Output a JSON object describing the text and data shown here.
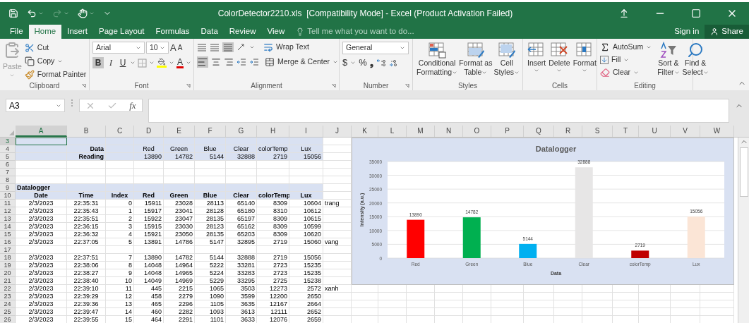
{
  "window": {
    "title": "ColorDetector2210.xls  [Compatibility Mode] - Excel (Product Activation Failed)"
  },
  "ribbon_tabs": [
    {
      "label": "File",
      "selected": false
    },
    {
      "label": "Home",
      "selected": true
    },
    {
      "label": "Insert",
      "selected": false
    },
    {
      "label": "Page Layout",
      "selected": false
    },
    {
      "label": "Formulas",
      "selected": false
    },
    {
      "label": "Data",
      "selected": false
    },
    {
      "label": "Review",
      "selected": false
    },
    {
      "label": "View",
      "selected": false
    }
  ],
  "tell_me": {
    "placeholder": "Tell me what you want to do..."
  },
  "account": {
    "sign_in": "Sign in",
    "share": "Share"
  },
  "ribbon": {
    "clipboard": {
      "paste": "Paste",
      "cut": "Cut",
      "copy": "Copy",
      "format_painter": "Format Painter",
      "label": "Clipboard"
    },
    "font": {
      "font_name": "Arial",
      "font_size": "10",
      "grow": "A",
      "shrink": "A",
      "bold": "B",
      "italic": "I",
      "underline": "U",
      "font_color": "A",
      "label": "Font"
    },
    "alignment": {
      "wrap_text": "Wrap Text",
      "merge": "Merge & Center",
      "label": "Alignment"
    },
    "number": {
      "format": "General",
      "currency": "$",
      "percent": "%",
      "comma": "❟",
      "label": "Number"
    },
    "styles": {
      "buttons": [
        [
          "Conditional",
          "Formatting"
        ],
        [
          "Format as",
          "Table"
        ],
        [
          "Cell",
          "Styles"
        ]
      ],
      "label": "Styles"
    },
    "cells": {
      "buttons": [
        "Insert",
        "Delete",
        "Format"
      ],
      "label": "Cells"
    },
    "editing": {
      "autosum": "AutoSum",
      "fill": "Fill",
      "clear": "Clear",
      "sort": [
        "Sort &",
        "Filter"
      ],
      "find": [
        "Find &",
        "Select"
      ],
      "label": "Editing"
    }
  },
  "formula_bar": {
    "name_box": "A3",
    "function_symbol": "fx"
  },
  "sheet": {
    "columns": [
      {
        "label": "A",
        "selected": true
      },
      {
        "label": "B",
        "selected": false
      },
      {
        "label": "C",
        "selected": false
      },
      {
        "label": "D",
        "selected": false
      },
      {
        "label": "E",
        "selected": false
      },
      {
        "label": "F",
        "selected": false
      },
      {
        "label": "G",
        "selected": false
      },
      {
        "label": "H",
        "selected": false
      },
      {
        "label": "I",
        "selected": false
      },
      {
        "label": "J",
        "selected": false
      },
      {
        "label": "K",
        "selected": false
      },
      {
        "label": "L",
        "selected": false
      },
      {
        "label": "M",
        "selected": false
      },
      {
        "label": "N",
        "selected": false
      },
      {
        "label": "O",
        "selected": false
      },
      {
        "label": "P",
        "selected": false
      },
      {
        "label": "Q",
        "selected": false
      },
      {
        "label": "R",
        "selected": false
      },
      {
        "label": "S",
        "selected": false
      },
      {
        "label": "T",
        "selected": false
      },
      {
        "label": "U",
        "selected": false
      },
      {
        "label": "V",
        "selected": false
      },
      {
        "label": "W",
        "selected": false
      }
    ],
    "rows": [
      {
        "number": "3",
        "kind": "blank",
        "shaded": true,
        "selected": true,
        "cells": {}
      },
      {
        "number": "4",
        "kind": "label",
        "shaded": true,
        "selected": false,
        "cells": {
          "B": "Data",
          "D": "Red",
          "E": "Green",
          "F": "Blue",
          "G": "Clear",
          "H": "colorTemp",
          "I": "Lux"
        }
      },
      {
        "number": "5",
        "kind": "reading",
        "shaded": true,
        "selected": false,
        "cells": {
          "B": "Reading",
          "D": "13890",
          "E": "14782",
          "F": "5144",
          "G": "32888",
          "H": "2719",
          "I": "15056"
        }
      },
      {
        "number": "6",
        "kind": "blank",
        "shaded": false,
        "selected": false,
        "cells": {}
      },
      {
        "number": "7",
        "kind": "blank",
        "shaded": false,
        "selected": false,
        "cells": {}
      },
      {
        "number": "8",
        "kind": "blank",
        "shaded": false,
        "selected": false,
        "cells": {}
      },
      {
        "number": "9",
        "kind": "section",
        "shaded": true,
        "selected": false,
        "cells": {
          "A": "Datalogger"
        }
      },
      {
        "number": "10",
        "kind": "header",
        "shaded": true,
        "selected": false,
        "cells": {
          "A": "Date",
          "B": "Time",
          "C": "Index",
          "D": "Red",
          "E": "Green",
          "F": "Blue",
          "G": "Clear",
          "H": "colorTemp",
          "I": "Lux"
        }
      },
      {
        "number": "11",
        "kind": "data",
        "shaded": false,
        "selected": false,
        "cells": {
          "A": "2/3/2023",
          "B": "22:35:31",
          "C": "0",
          "D": "15911",
          "E": "23028",
          "F": "28113",
          "G": "65140",
          "H": "8309",
          "I": "10604",
          "J": "trang"
        }
      },
      {
        "number": "12",
        "kind": "data",
        "shaded": false,
        "selected": false,
        "cells": {
          "A": "2/3/2023",
          "B": "22:35:43",
          "C": "1",
          "D": "15917",
          "E": "23041",
          "F": "28128",
          "G": "65180",
          "H": "8310",
          "I": "10612"
        }
      },
      {
        "number": "13",
        "kind": "data",
        "shaded": false,
        "selected": false,
        "cells": {
          "A": "2/3/2023",
          "B": "22:35:51",
          "C": "2",
          "D": "15922",
          "E": "23047",
          "F": "28135",
          "G": "65197",
          "H": "8309",
          "I": "10615"
        }
      },
      {
        "number": "14",
        "kind": "data",
        "shaded": false,
        "selected": false,
        "cells": {
          "A": "2/3/2023",
          "B": "22:36:15",
          "C": "3",
          "D": "15915",
          "E": "23030",
          "F": "28123",
          "G": "65162",
          "H": "8309",
          "I": "10599"
        }
      },
      {
        "number": "15",
        "kind": "data",
        "shaded": false,
        "selected": false,
        "cells": {
          "A": "2/3/2023",
          "B": "22:36:32",
          "C": "4",
          "D": "15921",
          "E": "23050",
          "F": "28135",
          "G": "65203",
          "H": "8309",
          "I": "10620"
        }
      },
      {
        "number": "16",
        "kind": "data",
        "shaded": false,
        "selected": false,
        "cells": {
          "A": "2/3/2023",
          "B": "22:37:05",
          "C": "5",
          "D": "13891",
          "E": "14786",
          "F": "5147",
          "G": "32895",
          "H": "2719",
          "I": "15060",
          "J": "vang"
        }
      },
      {
        "number": "17",
        "kind": "blank",
        "shaded": false,
        "selected": false,
        "cells": {}
      },
      {
        "number": "18",
        "kind": "data",
        "shaded": false,
        "selected": false,
        "cells": {
          "A": "2/3/2023",
          "B": "22:37:51",
          "C": "7",
          "D": "13890",
          "E": "14782",
          "F": "5144",
          "G": "32888",
          "H": "2719",
          "I": "15056"
        }
      },
      {
        "number": "19",
        "kind": "data",
        "shaded": false,
        "selected": false,
        "cells": {
          "A": "2/3/2023",
          "B": "22:38:06",
          "C": "8",
          "D": "14048",
          "E": "14964",
          "F": "5222",
          "G": "33281",
          "H": "2723",
          "I": "15235"
        }
      },
      {
        "number": "20",
        "kind": "data",
        "shaded": false,
        "selected": false,
        "cells": {
          "A": "2/3/2023",
          "B": "22:38:27",
          "C": "9",
          "D": "14048",
          "E": "14965",
          "F": "5224",
          "G": "33283",
          "H": "2723",
          "I": "15235"
        }
      },
      {
        "number": "21",
        "kind": "data",
        "shaded": false,
        "selected": false,
        "cells": {
          "A": "2/3/2023",
          "B": "22:38:40",
          "C": "10",
          "D": "14049",
          "E": "14969",
          "F": "5229",
          "G": "33295",
          "H": "2725",
          "I": "15238"
        }
      },
      {
        "number": "22",
        "kind": "data",
        "shaded": false,
        "selected": false,
        "cells": {
          "A": "2/3/2023",
          "B": "22:39:10",
          "C": "11",
          "D": "445",
          "E": "2215",
          "F": "1065",
          "G": "3503",
          "H": "12273",
          "I": "2572",
          "J": "xanh"
        }
      },
      {
        "number": "23",
        "kind": "data",
        "shaded": false,
        "selected": false,
        "cells": {
          "A": "2/3/2023",
          "B": "22:39:29",
          "C": "12",
          "D": "458",
          "E": "2279",
          "F": "1090",
          "G": "3599",
          "H": "12200",
          "I": "2650"
        }
      },
      {
        "number": "24",
        "kind": "data",
        "shaded": false,
        "selected": false,
        "cells": {
          "A": "2/3/2023",
          "B": "22:39:36",
          "C": "13",
          "D": "465",
          "E": "2296",
          "F": "1105",
          "G": "3635",
          "H": "12167",
          "I": "2664"
        }
      },
      {
        "number": "25",
        "kind": "data",
        "shaded": false,
        "selected": false,
        "cells": {
          "A": "2/3/2023",
          "B": "22:39:47",
          "C": "14",
          "D": "460",
          "E": "2282",
          "F": "1093",
          "G": "3613",
          "H": "12111",
          "I": "2652"
        }
      },
      {
        "number": "26",
        "kind": "data",
        "shaded": false,
        "selected": false,
        "cells": {
          "A": "2/3/2023",
          "B": "22:39:55",
          "C": "15",
          "D": "464",
          "E": "2291",
          "F": "1101",
          "G": "3633",
          "H": "12076",
          "I": "2659"
        }
      }
    ]
  },
  "chart": {
    "chart_data": {
      "type": "bar",
      "title": "Datalogger",
      "xlabel": "Data",
      "ylabel": "Intensity (a.u.)",
      "categories": [
        "Red",
        "Green",
        "Blue",
        "Clear",
        "colorTemp",
        "Lux"
      ],
      "values": [
        13890,
        14782,
        5144,
        32888,
        2719,
        15056
      ],
      "colors": [
        "#ff0000",
        "#00b050",
        "#00b0f0",
        "#e7e6e6",
        "#c00000",
        "#fbe5d6"
      ],
      "grid": true,
      "ylim": [
        0,
        35000
      ],
      "yticks": [
        0,
        5000,
        10000,
        15000,
        20000,
        25000,
        30000,
        35000
      ],
      "data_labels": true
    }
  }
}
